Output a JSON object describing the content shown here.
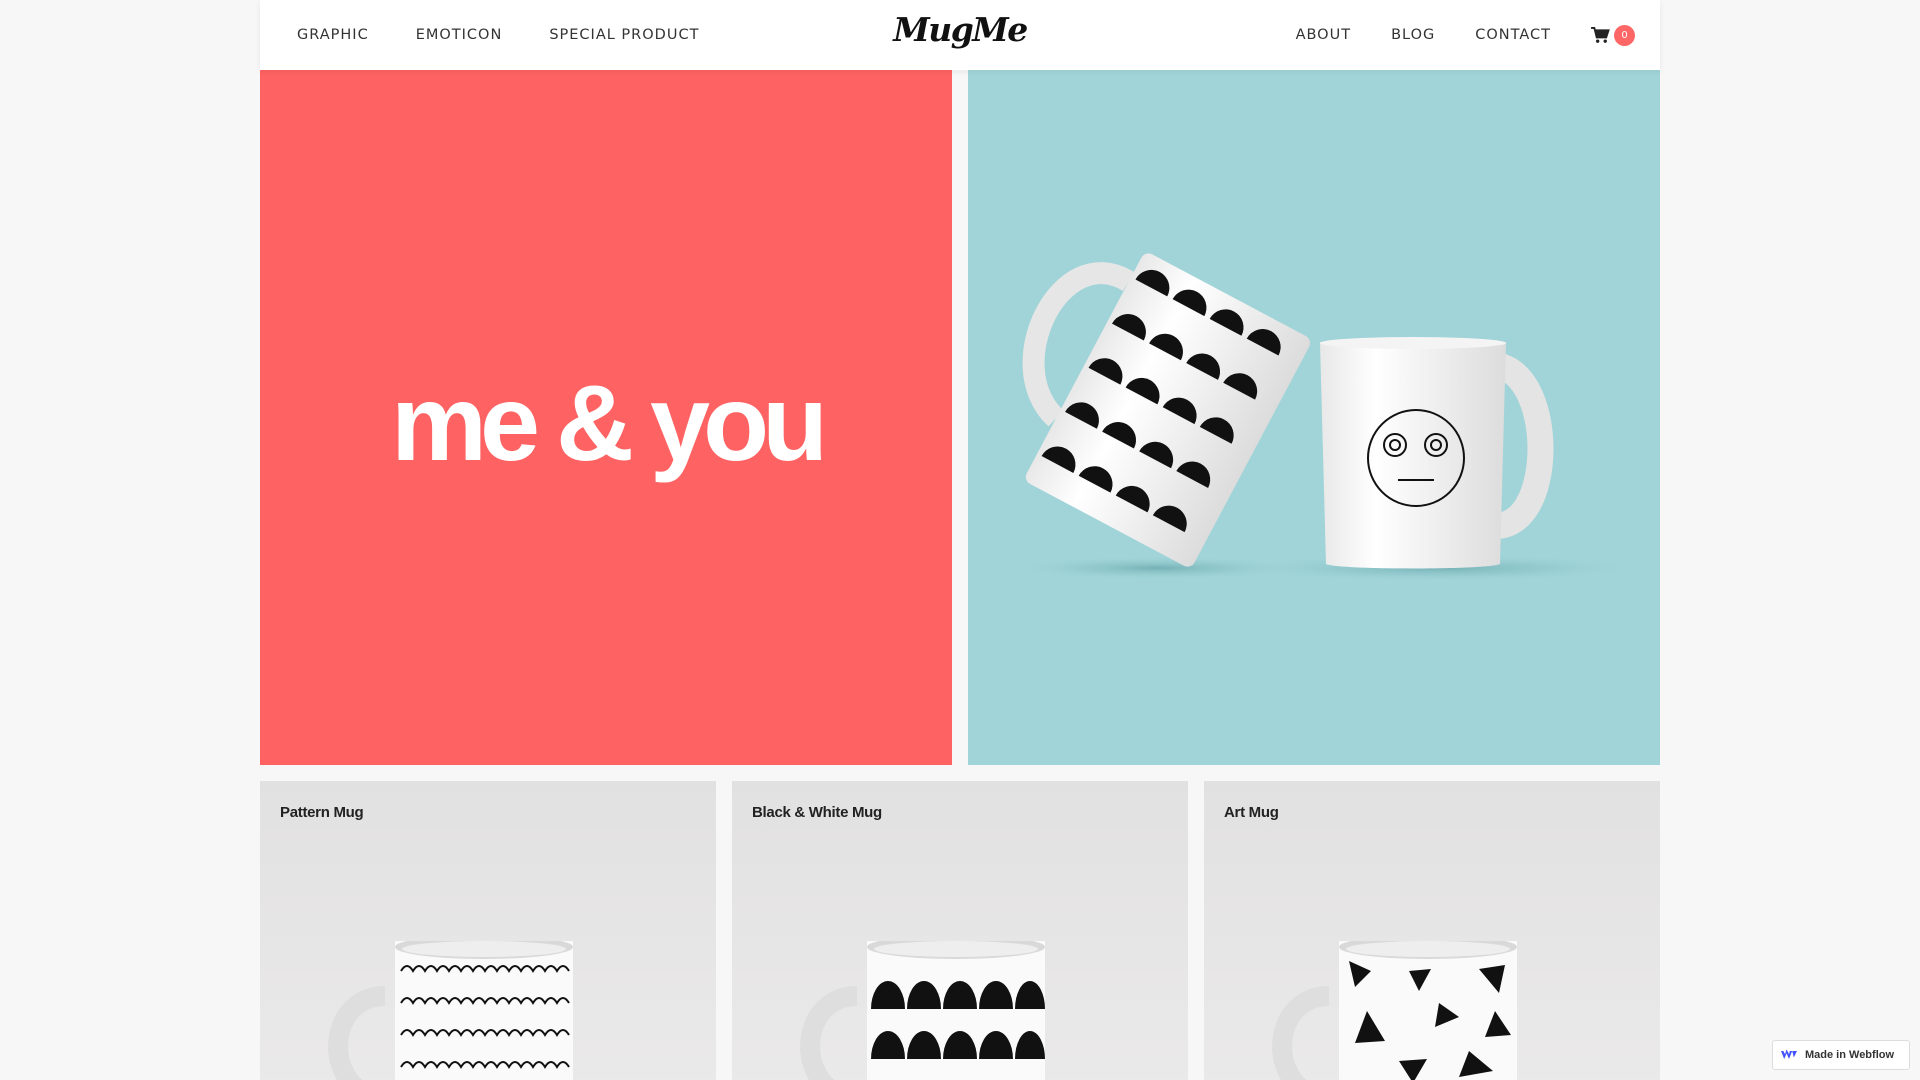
{
  "nav": {
    "left_links": [
      "GRAPHIC",
      "EMOTICON",
      "SPECIAL PRODUCT"
    ],
    "logo": "MugMe",
    "right_links": [
      "ABOUT",
      "BLOG",
      "CONTACT"
    ],
    "cart_count": "0"
  },
  "hero": {
    "tagline": "me & you"
  },
  "products": [
    {
      "name": "Pattern Mug"
    },
    {
      "name": "Black & White Mug"
    },
    {
      "name": "Art Mug"
    }
  ],
  "badge": {
    "label": "Made in Webflow"
  },
  "colors": {
    "hero_left_bg": "#fe6262",
    "hero_right_bg": "#a0d4d8",
    "cart_badge": "#ff6666"
  }
}
